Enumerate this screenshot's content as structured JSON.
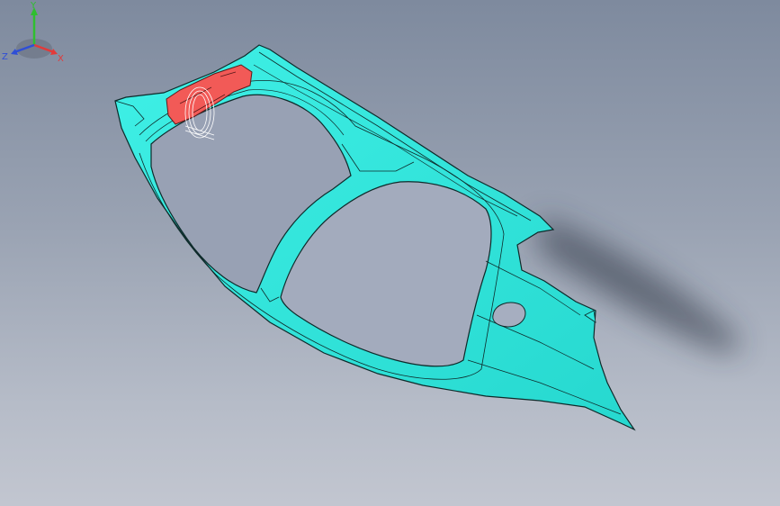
{
  "viewport": {
    "background_top": "#7e8a9e",
    "background_bottom": "#c2c6d0"
  },
  "model": {
    "body_color": "#2ee6dc",
    "edge_color": "#0e2a2a",
    "highlight_color": "#f25a57"
  },
  "triad": {
    "y_label": "Y",
    "x_label": "X",
    "z_label": "Z",
    "y_color": "#2fbf2f",
    "x_color": "#e23a3a",
    "z_color": "#2f4fd6"
  }
}
